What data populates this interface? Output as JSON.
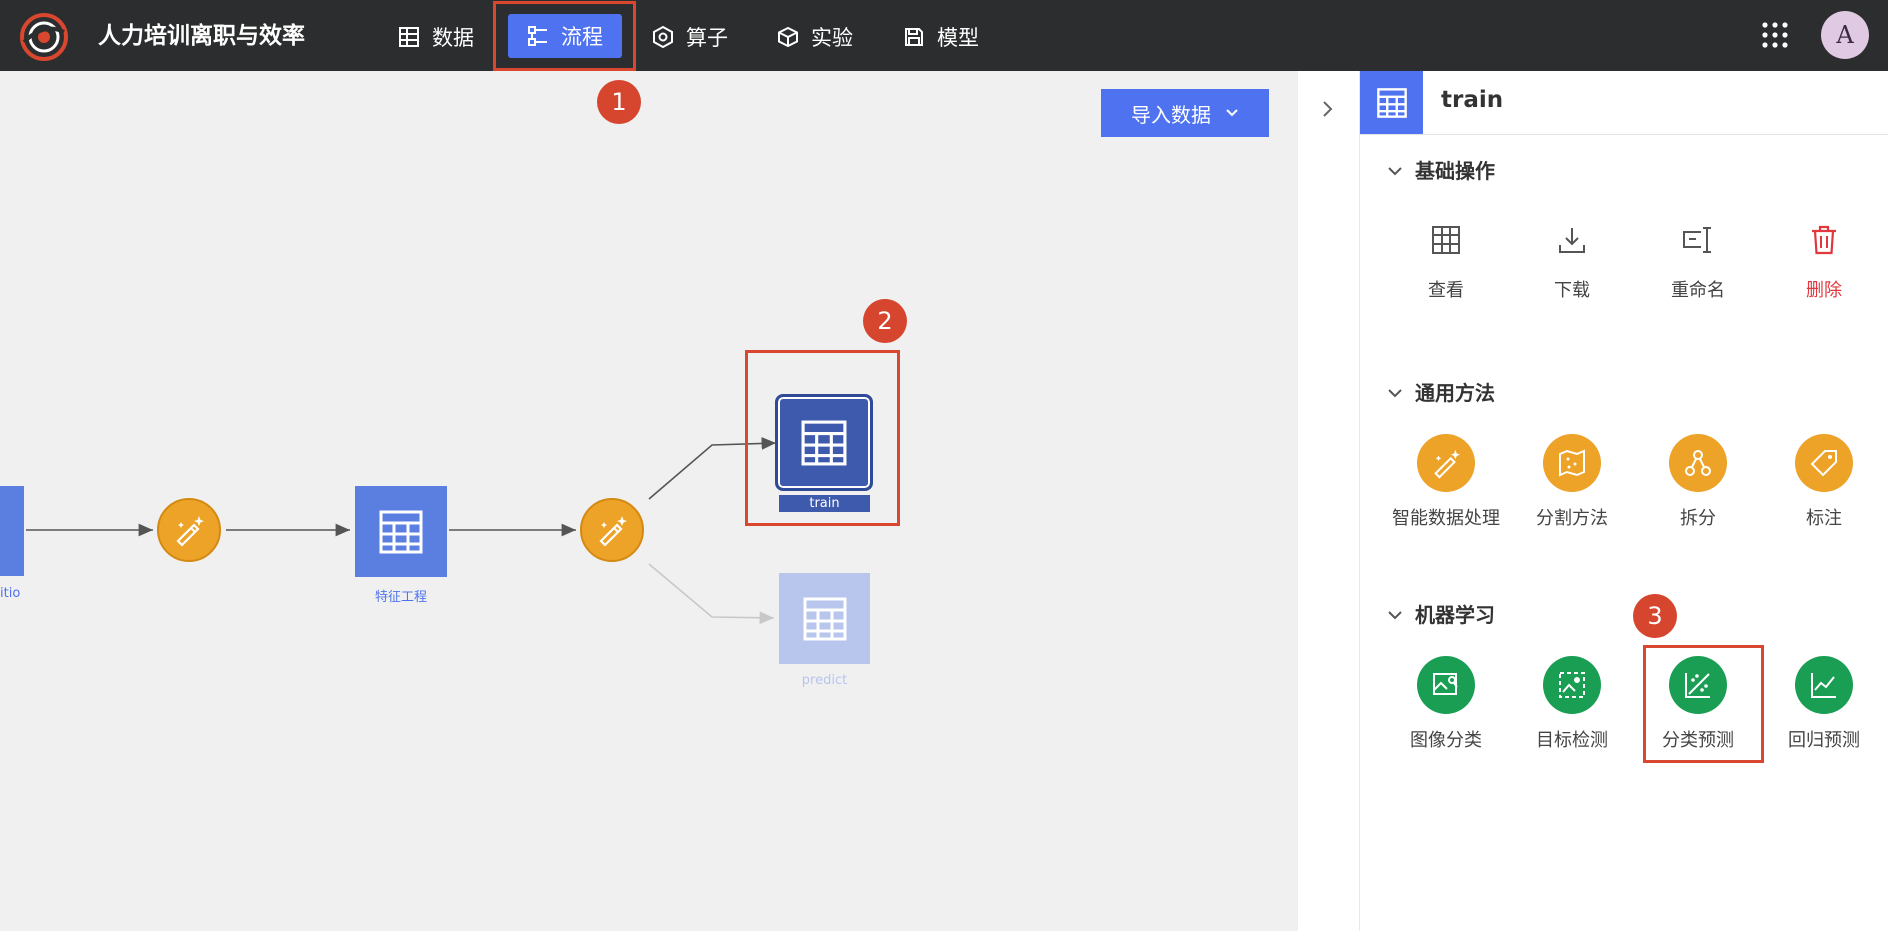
{
  "app": {
    "title": "人力培训离职与效率"
  },
  "nav": {
    "items": [
      {
        "label": "数据",
        "icon": "table-icon"
      },
      {
        "label": "流程",
        "icon": "flow-icon"
      },
      {
        "label": "算子",
        "icon": "hexagon-gear-icon"
      },
      {
        "label": "实验",
        "icon": "cube-icon"
      },
      {
        "label": "模型",
        "icon": "save-icon"
      }
    ],
    "active": "流程"
  },
  "user": {
    "avatar_letter": "A"
  },
  "annotations": {
    "n1": "1",
    "n2": "2",
    "n3": "3"
  },
  "canvas": {
    "import_button": "导入数据",
    "nodes": {
      "partial": "itio",
      "feature": "特征工程",
      "train": "train",
      "predict": "predict"
    }
  },
  "panel": {
    "title": "train",
    "sections": {
      "basic": {
        "title": "基础操作",
        "items": [
          "查看",
          "下载",
          "重命名",
          "删除"
        ]
      },
      "general": {
        "title": "通用方法",
        "items": [
          "智能数据处理",
          "分割方法",
          "拆分",
          "标注"
        ]
      },
      "ml": {
        "title": "机器学习",
        "items": [
          "图像分类",
          "目标检测",
          "分类预测",
          "回归预测"
        ]
      }
    }
  },
  "colors": {
    "accent": "#4f73f0",
    "topbar": "#2b2d2e",
    "highlight": "#d9472f",
    "orange": "#eda228",
    "green": "#1a9e54",
    "delete": "#e0383e"
  }
}
